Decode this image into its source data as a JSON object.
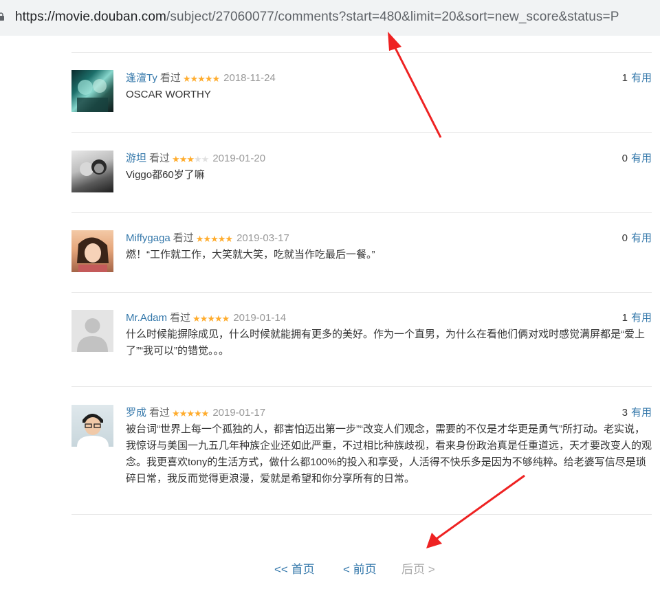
{
  "browser": {
    "url_host": "https://movie.douban.com",
    "url_path": "/subject/27060077/comments?start=480&limit=20&sort=new_score&status=P"
  },
  "comments": [
    {
      "user": "逢澶Ty",
      "status": "看过",
      "rating": 5,
      "date": "2018-11-24",
      "votes": "1",
      "useful": "有用",
      "text": "OSCAR WORTHY"
    },
    {
      "user": "游坦",
      "status": "看过",
      "rating": 3,
      "date": "2019-01-20",
      "votes": "0",
      "useful": "有用",
      "text": "Viggo都60岁了嘛"
    },
    {
      "user": "Miffygaga",
      "status": "看过",
      "rating": 5,
      "date": "2019-03-17",
      "votes": "0",
      "useful": "有用",
      "text": "燃！“工作就工作，大笑就大笑，吃就当作吃最后一餐。”"
    },
    {
      "user": "Mr.Adam",
      "status": "看过",
      "rating": 5,
      "date": "2019-01-14",
      "votes": "1",
      "useful": "有用",
      "text": "什么时候能摒除成见，什么时候就能拥有更多的美好。作为一个直男，为什么在看他们俩对戏时感觉满屏都是“爱上了”“我可以”的错觉。。。"
    },
    {
      "user": "罗成",
      "status": "看过",
      "rating": 5,
      "date": "2019-01-17",
      "votes": "3",
      "useful": "有用",
      "text": "被台词“世界上每一个孤独的人，都害怕迈出第一步”“改变人们观念，需要的不仅是才华更是勇气”所打动。老实说，我惊讶与美国一九五几年种族企业还如此严重，不过相比种族歧视，看来身份政治真是任重道远，天才要改变人的观念。我更喜欢tony的生活方式，做什么都100%的投入和享受，人活得不快乐多是因为不够纯粹。给老婆写信尽是琐碎日常，我反而觉得更浪漫，爱就是希望和你分享所有的日常。"
    }
  ],
  "pagination": {
    "first": "<< 首页",
    "prev": "< 前页",
    "next": "后页 >"
  },
  "colors": {
    "link": "#3377aa",
    "star": "#ffac2d",
    "annotation_arrow": "#ee2222"
  }
}
